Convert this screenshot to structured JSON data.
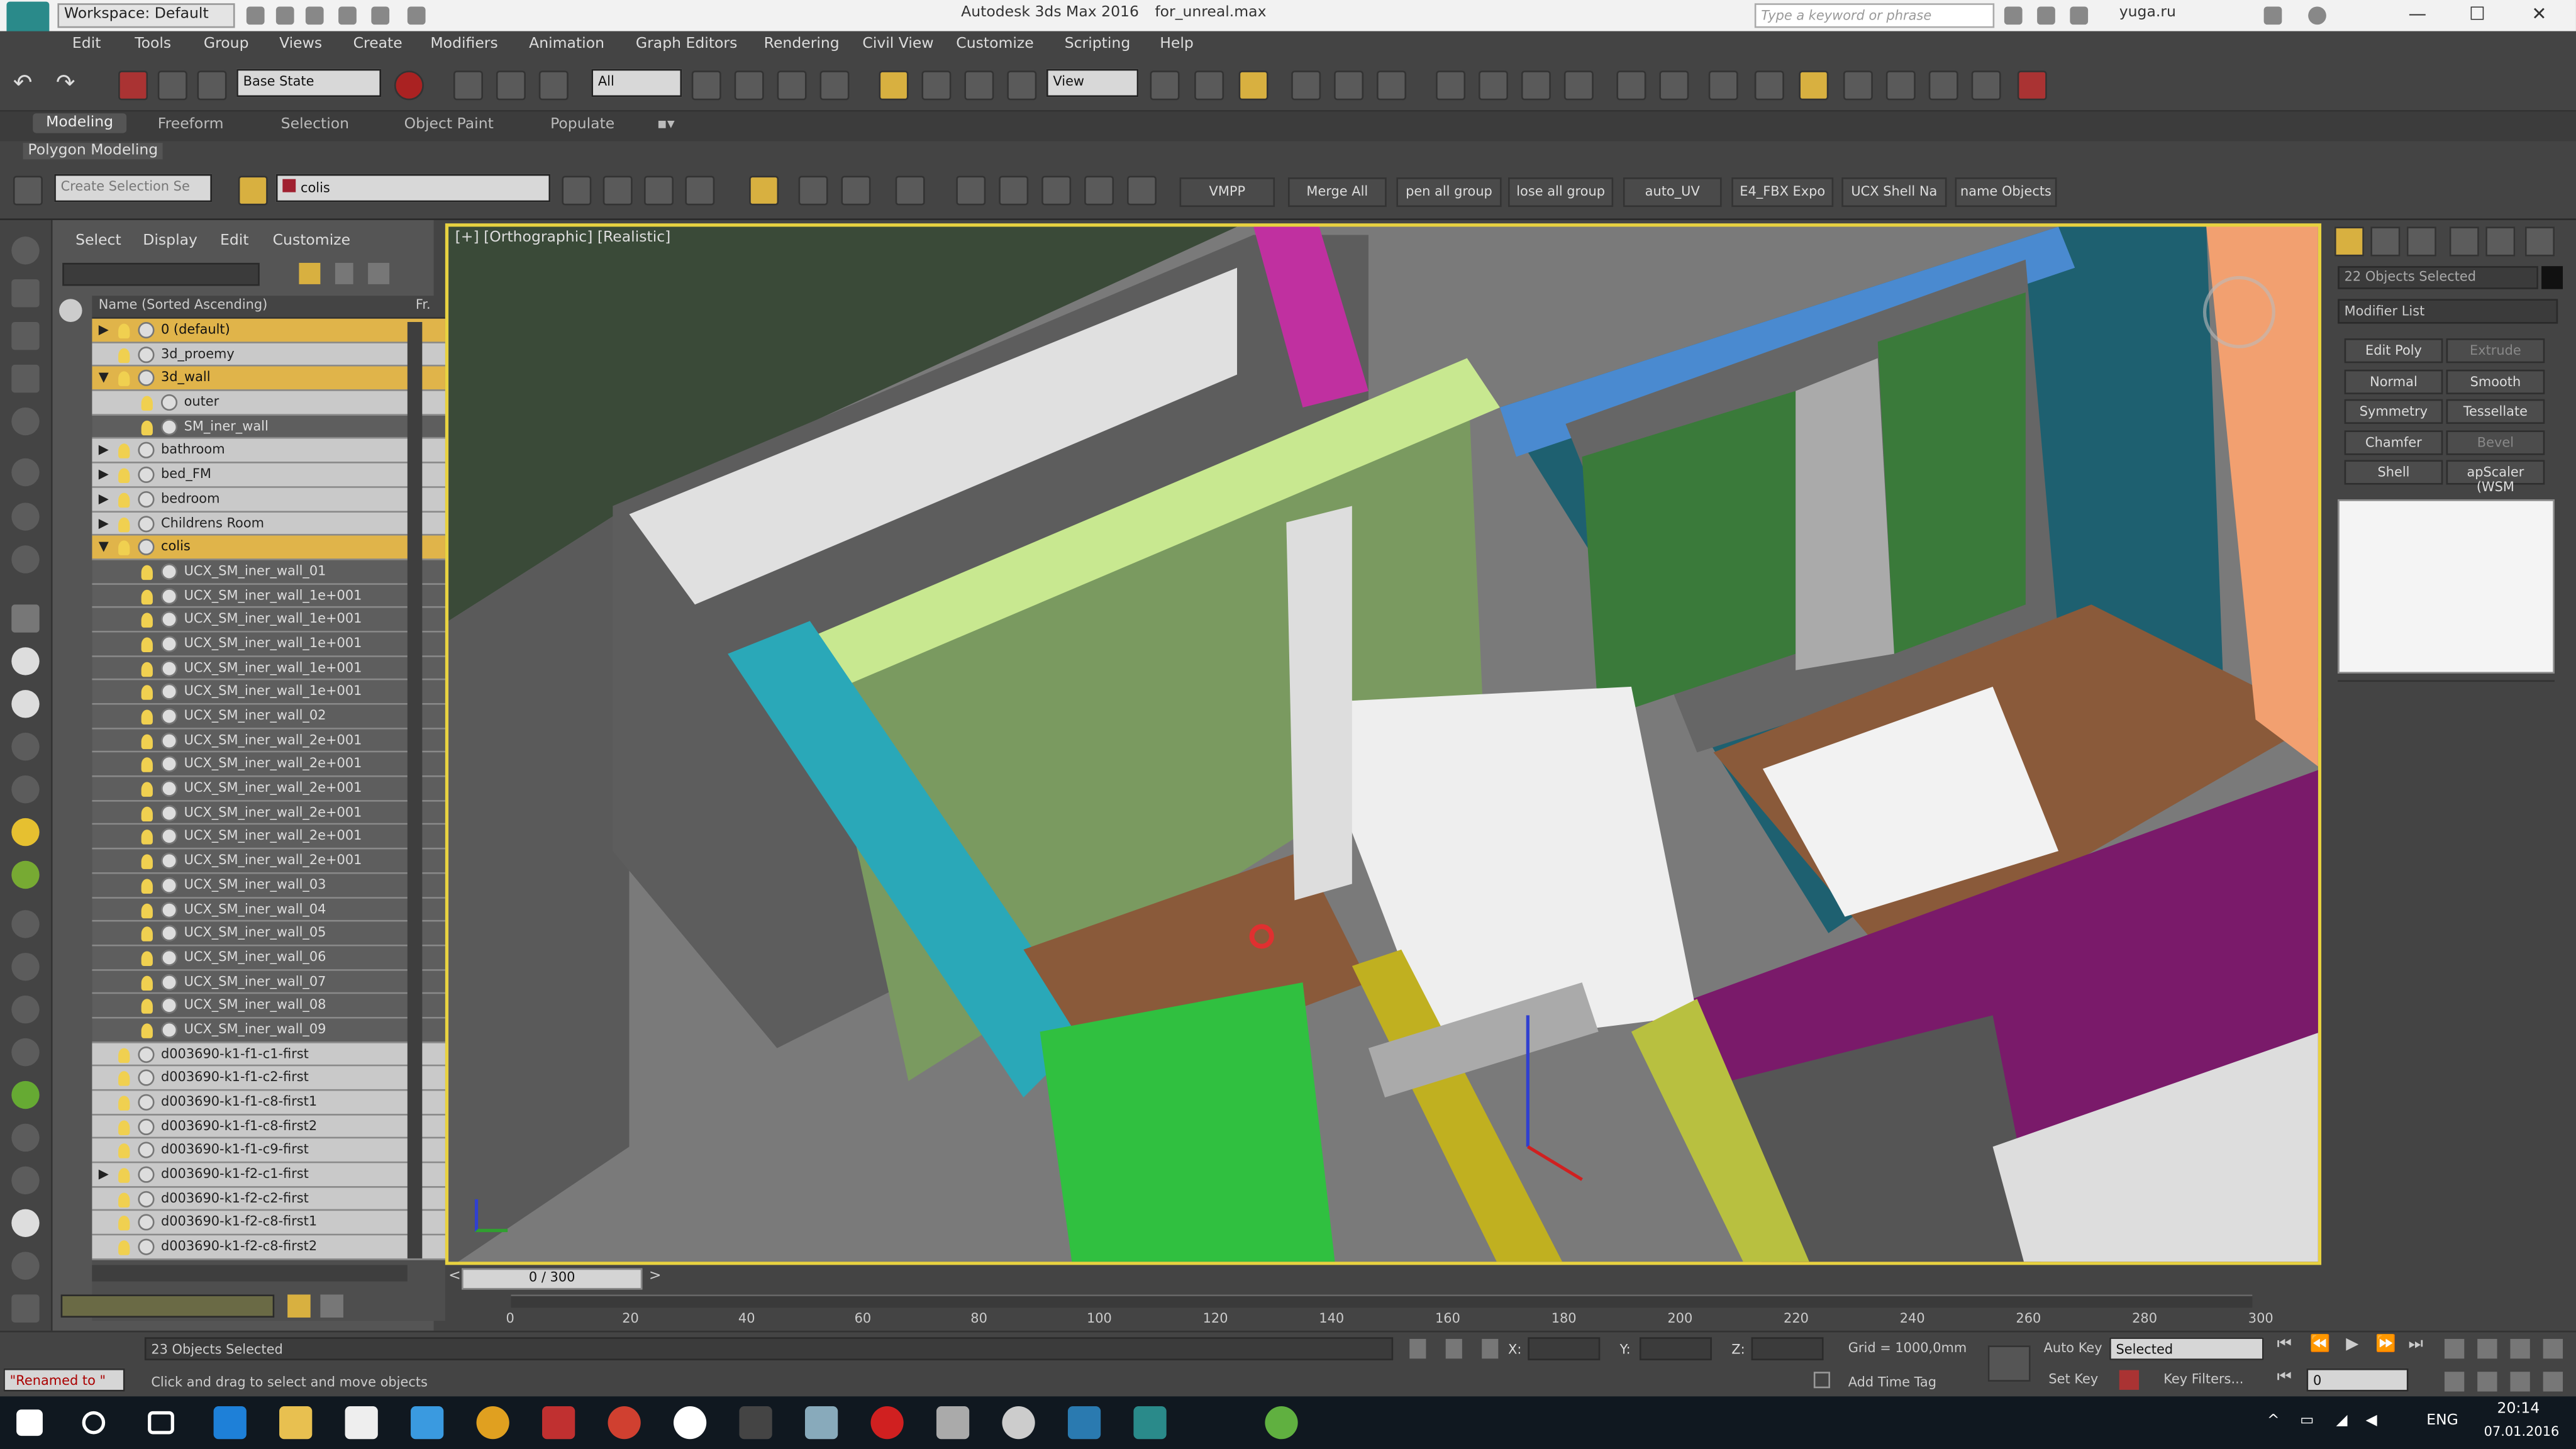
{
  "app": {
    "title": "Autodesk 3ds Max 2016",
    "file": "for_unreal.max",
    "workspace": "Workspace: Default",
    "search_placeholder": "Type a keyword or phrase",
    "user": "yuga.ru"
  },
  "menubar": [
    "Edit",
    "Tools",
    "Group",
    "Views",
    "Create",
    "Modifiers",
    "Animation",
    "Graph Editors",
    "Rendering",
    "Civil View",
    "Customize",
    "Scripting",
    "Help"
  ],
  "toolbar1": {
    "state": "Base State",
    "filter": "All",
    "refcoord": "View"
  },
  "ribbon": {
    "tabs": [
      "Modeling",
      "Freeform",
      "Selection",
      "Object Paint",
      "Populate"
    ],
    "subtitle": "Polygon Modeling"
  },
  "toolbar2": {
    "selection_set_placeholder": "Create Selection Se",
    "layer": "colis",
    "buttons": [
      "VMPP",
      "Merge All",
      "pen all group",
      "lose all group",
      "auto_UV",
      "E4_FBX Expo",
      "UCX Shell Na",
      "name Objects"
    ]
  },
  "explorer": {
    "menu": [
      "Select",
      "Display",
      "Edit",
      "Customize"
    ],
    "column": "Name (Sorted Ascending)",
    "col2": "Fr.",
    "rows": [
      {
        "label": "0 (default)",
        "indent": 0,
        "style": "sel",
        "arrow": "▶"
      },
      {
        "label": "3d_proemy",
        "indent": 0,
        "style": "light",
        "arrow": ""
      },
      {
        "label": "3d_wall",
        "indent": 0,
        "style": "sel",
        "arrow": "▼"
      },
      {
        "label": "outer",
        "indent": 1,
        "style": "light",
        "arrow": ""
      },
      {
        "label": "SM_iner_wall",
        "indent": 1,
        "style": "dark",
        "arrow": ""
      },
      {
        "label": "bathroom",
        "indent": 0,
        "style": "light",
        "arrow": "▶"
      },
      {
        "label": "bed_FM",
        "indent": 0,
        "style": "light",
        "arrow": "▶"
      },
      {
        "label": "bedroom",
        "indent": 0,
        "style": "light",
        "arrow": "▶"
      },
      {
        "label": "Childrens Room",
        "indent": 0,
        "style": "light",
        "arrow": "▶"
      },
      {
        "label": "colis",
        "indent": 0,
        "style": "sel",
        "arrow": "▼"
      },
      {
        "label": "UCX_SM_iner_wall_01",
        "indent": 1,
        "style": "dark",
        "arrow": ""
      },
      {
        "label": "UCX_SM_iner_wall_1e+001",
        "indent": 1,
        "style": "dark",
        "arrow": ""
      },
      {
        "label": "UCX_SM_iner_wall_1e+001",
        "indent": 1,
        "style": "dark",
        "arrow": ""
      },
      {
        "label": "UCX_SM_iner_wall_1e+001",
        "indent": 1,
        "style": "dark",
        "arrow": ""
      },
      {
        "label": "UCX_SM_iner_wall_1e+001",
        "indent": 1,
        "style": "dark",
        "arrow": ""
      },
      {
        "label": "UCX_SM_iner_wall_1e+001",
        "indent": 1,
        "style": "dark",
        "arrow": ""
      },
      {
        "label": "UCX_SM_iner_wall_02",
        "indent": 1,
        "style": "dark",
        "arrow": ""
      },
      {
        "label": "UCX_SM_iner_wall_2e+001",
        "indent": 1,
        "style": "dark",
        "arrow": ""
      },
      {
        "label": "UCX_SM_iner_wall_2e+001",
        "indent": 1,
        "style": "dark",
        "arrow": ""
      },
      {
        "label": "UCX_SM_iner_wall_2e+001",
        "indent": 1,
        "style": "dark",
        "arrow": ""
      },
      {
        "label": "UCX_SM_iner_wall_2e+001",
        "indent": 1,
        "style": "dark",
        "arrow": ""
      },
      {
        "label": "UCX_SM_iner_wall_2e+001",
        "indent": 1,
        "style": "dark",
        "arrow": ""
      },
      {
        "label": "UCX_SM_iner_wall_2e+001",
        "indent": 1,
        "style": "dark",
        "arrow": ""
      },
      {
        "label": "UCX_SM_iner_wall_03",
        "indent": 1,
        "style": "dark",
        "arrow": ""
      },
      {
        "label": "UCX_SM_iner_wall_04",
        "indent": 1,
        "style": "dark",
        "arrow": ""
      },
      {
        "label": "UCX_SM_iner_wall_05",
        "indent": 1,
        "style": "dark",
        "arrow": ""
      },
      {
        "label": "UCX_SM_iner_wall_06",
        "indent": 1,
        "style": "dark",
        "arrow": ""
      },
      {
        "label": "UCX_SM_iner_wall_07",
        "indent": 1,
        "style": "dark",
        "arrow": ""
      },
      {
        "label": "UCX_SM_iner_wall_08",
        "indent": 1,
        "style": "dark",
        "arrow": ""
      },
      {
        "label": "UCX_SM_iner_wall_09",
        "indent": 1,
        "style": "dark",
        "arrow": ""
      },
      {
        "label": "d003690-k1-f1-c1-first",
        "indent": 0,
        "style": "light",
        "arrow": ""
      },
      {
        "label": "d003690-k1-f1-c2-first",
        "indent": 0,
        "style": "light",
        "arrow": ""
      },
      {
        "label": "d003690-k1-f1-c8-first1",
        "indent": 0,
        "style": "light",
        "arrow": ""
      },
      {
        "label": "d003690-k1-f1-c8-first2",
        "indent": 0,
        "style": "light",
        "arrow": ""
      },
      {
        "label": "d003690-k1-f1-c9-first",
        "indent": 0,
        "style": "light",
        "arrow": ""
      },
      {
        "label": "d003690-k1-f2-c1-first",
        "indent": 0,
        "style": "light",
        "arrow": "▶"
      },
      {
        "label": "d003690-k1-f2-c2-first",
        "indent": 0,
        "style": "light",
        "arrow": ""
      },
      {
        "label": "d003690-k1-f2-c8-first1",
        "indent": 0,
        "style": "light",
        "arrow": ""
      },
      {
        "label": "d003690-k1-f2-c8-first2",
        "indent": 0,
        "style": "light",
        "arrow": ""
      }
    ]
  },
  "viewport": {
    "label": "[+] [Orthographic] [Realistic]"
  },
  "cmdpanel": {
    "selected": "22 Objects Selected",
    "modifier_list": "Modifier List",
    "buttons": [
      {
        "label": "Edit Poly",
        "disabled": false
      },
      {
        "label": "Extrude",
        "disabled": true
      },
      {
        "label": "Normal",
        "disabled": false
      },
      {
        "label": "Smooth",
        "disabled": false
      },
      {
        "label": "Symmetry",
        "disabled": false
      },
      {
        "label": "Tessellate",
        "disabled": false
      },
      {
        "label": "Chamfer",
        "disabled": false
      },
      {
        "label": "Bevel",
        "disabled": true
      },
      {
        "label": "Shell",
        "disabled": false
      },
      {
        "label": "apScaler (WSM",
        "disabled": false
      }
    ]
  },
  "timeline": {
    "frame": "0 / 300",
    "ticks": [
      "0",
      "20",
      "40",
      "60",
      "80",
      "100",
      "120",
      "140",
      "160",
      "180",
      "200",
      "220",
      "240",
      "260",
      "280",
      "300"
    ]
  },
  "status": {
    "objects": "23 Objects Selected",
    "prompt": "Click and drag to select and move objects",
    "renamed": "\"Renamed to \"",
    "x_label": "X:",
    "y_label": "Y:",
    "z_label": "Z:",
    "grid": "Grid = 1000,0mm",
    "autokey": "Auto Key",
    "selected": "Selected",
    "setkey": "Set Key",
    "keyfilters": "Key Filters...",
    "add_time_tag": "Add Time Tag",
    "frame_field": "0"
  },
  "taskbar": {
    "lang": "ENG",
    "time": "20:14",
    "date": "07.01.2016"
  },
  "colors": {
    "accent_yellow": "#e8d240",
    "selected_row": "#e0b44a"
  }
}
